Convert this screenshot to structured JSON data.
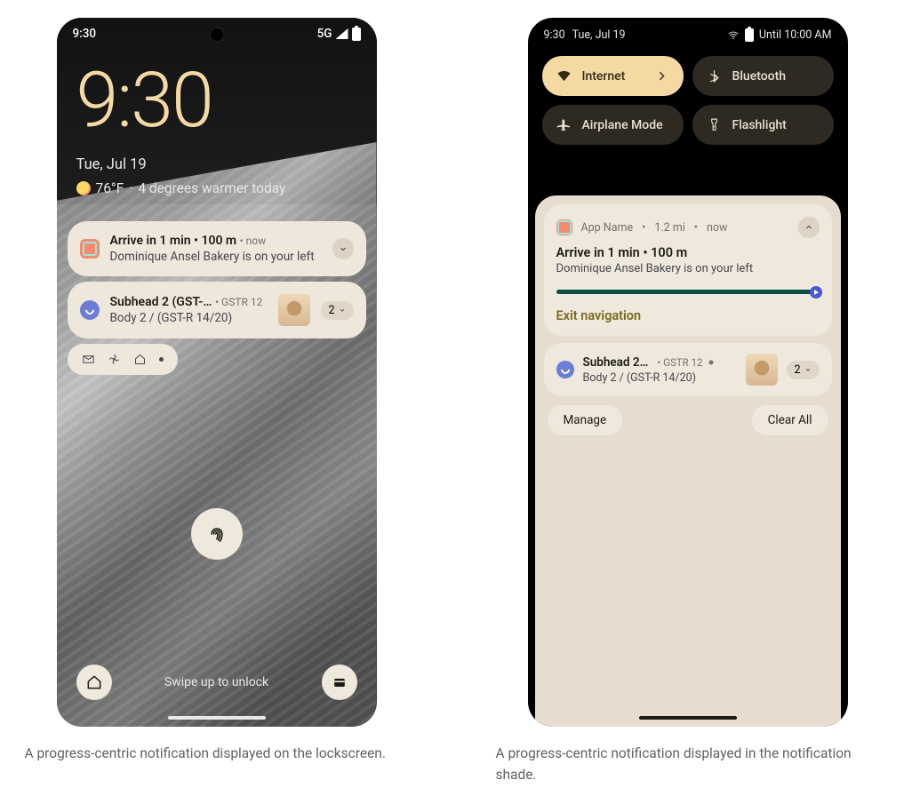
{
  "lock": {
    "status_time": "9:30",
    "status_net": "5G",
    "clock": "9:30",
    "date": "Tue, Jul 19",
    "temp": "76°F",
    "weather_detail": "4 degrees warmer today",
    "notif1": {
      "title": "Arrive in 1 min • 100 m",
      "meta": "• now",
      "sub": "Dominique Ansel Bakery is on your left"
    },
    "notif2": {
      "title": "Subhead 2 (GST-…",
      "meta": "• GSTR 12",
      "sub": "Body 2 / (GST-R 14/20)",
      "count": "2"
    },
    "swipe": "Swipe up to unlock"
  },
  "shade": {
    "status_time": "9:30",
    "status_date": "Tue, Jul 19",
    "dnd_until": "Until 10:00 AM",
    "tiles": {
      "internet": "Internet",
      "bluetooth": "Bluetooth",
      "airplane": "Airplane Mode",
      "flashlight": "Flashlight"
    },
    "card1": {
      "app": "App Name",
      "distance": "1.2 mi",
      "time": "now",
      "title": "Arrive in 1 min • 100 m",
      "sub": "Dominique Ansel Bakery is on your left",
      "exit": "Exit navigation"
    },
    "card2": {
      "title": "Subhead 2…",
      "meta": "• GSTR 12",
      "sub": "Body 2 / (GST-R 14/20)",
      "count": "2"
    },
    "manage": "Manage",
    "clear": "Clear All"
  },
  "captions": {
    "c1": "A progress-centric notification displayed on the lockscreen.",
    "c2": "A progress-centric notification displayed in the notification shade."
  }
}
